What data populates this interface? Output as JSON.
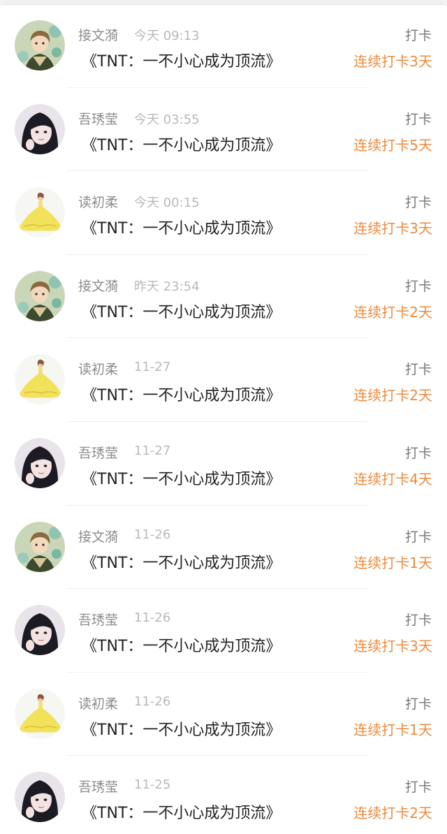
{
  "feed": {
    "items": [
      {
        "user": "接文漪",
        "time": "今天 09:13",
        "book": "《TNT：一不小心成为顶流》",
        "action": "打卡",
        "streak": "连续打卡3天",
        "avatar": "boy-anime-avatar"
      },
      {
        "user": "吾琇莹",
        "time": "今天 03:55",
        "book": "《TNT：一不小心成为顶流》",
        "action": "打卡",
        "streak": "连续打卡5天",
        "avatar": "girl-photo-avatar"
      },
      {
        "user": "读初柔",
        "time": "今天 00:15",
        "book": "《TNT：一不小心成为顶流》",
        "action": "打卡",
        "streak": "连续打卡3天",
        "avatar": "yellow-dress-avatar"
      },
      {
        "user": "接文漪",
        "time": "昨天 23:54",
        "book": "《TNT：一不小心成为顶流》",
        "action": "打卡",
        "streak": "连续打卡2天",
        "avatar": "boy-anime-avatar"
      },
      {
        "user": "读初柔",
        "time": "11-27",
        "book": "《TNT：一不小心成为顶流》",
        "action": "打卡",
        "streak": "连续打卡2天",
        "avatar": "yellow-dress-avatar"
      },
      {
        "user": "吾琇莹",
        "time": "11-27",
        "book": "《TNT：一不小心成为顶流》",
        "action": "打卡",
        "streak": "连续打卡4天",
        "avatar": "girl-photo-avatar"
      },
      {
        "user": "接文漪",
        "time": "11-26",
        "book": "《TNT：一不小心成为顶流》",
        "action": "打卡",
        "streak": "连续打卡1天",
        "avatar": "boy-anime-avatar"
      },
      {
        "user": "吾琇莹",
        "time": "11-26",
        "book": "《TNT：一不小心成为顶流》",
        "action": "打卡",
        "streak": "连续打卡3天",
        "avatar": "girl-photo-avatar"
      },
      {
        "user": "读初柔",
        "time": "11-26",
        "book": "《TNT：一不小心成为顶流》",
        "action": "打卡",
        "streak": "连续打卡1天",
        "avatar": "yellow-dress-avatar"
      },
      {
        "user": "吾琇莹",
        "time": "11-25",
        "book": "《TNT：一不小心成为顶流》",
        "action": "打卡",
        "streak": "连续打卡2天",
        "avatar": "girl-photo-avatar"
      }
    ]
  },
  "colors": {
    "streak": "#ee8a3c",
    "name": "#8c8c8c",
    "time": "#b9b9b9",
    "title": "#222222",
    "action": "#777777"
  }
}
